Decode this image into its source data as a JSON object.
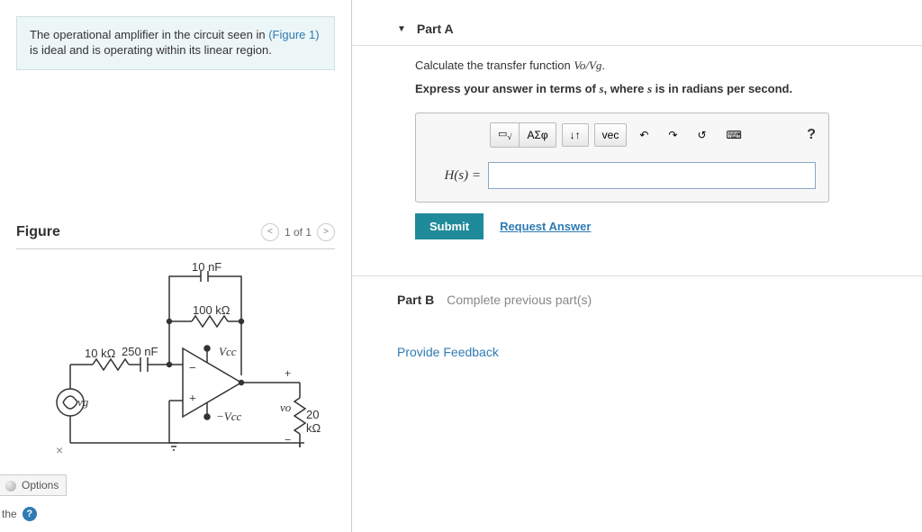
{
  "intro": {
    "text_before": "The operational amplifier in the circuit seen in ",
    "link": "(Figure 1)",
    "text_after": " is ideal and is operating within its linear region."
  },
  "figure": {
    "title": "Figure",
    "counter": "1 of 1",
    "labels": {
      "c_top": "10 nF",
      "r_fb": "100 kΩ",
      "r_in": "10 kΩ",
      "c_in": "250 nF",
      "vcc_pos": "Vcc",
      "vcc_neg": "−Vcc",
      "vg": "vg",
      "vo": "vo",
      "r_load": "20 kΩ",
      "plus": "+",
      "minus": "−"
    }
  },
  "options_label": "Options",
  "the_label": "the",
  "partA": {
    "header": "Part A",
    "prompt_pre": "Calculate the transfer function ",
    "prompt_expr": "Vo/Vg",
    "prompt_post": ".",
    "instruction_pre": "Express your answer in terms of ",
    "instruction_var": "s",
    "instruction_mid": ", where ",
    "instruction_var2": "s",
    "instruction_post": " is in radians per second.",
    "toolbar": {
      "templates": "▭√▭",
      "greek": "ΑΣφ",
      "subscript": "↓↑",
      "vec": "vec",
      "undo": "↶",
      "redo": "↷",
      "reset": "↺",
      "keyboard": "⌨",
      "help": "?"
    },
    "lhs": "H(s) =",
    "submit": "Submit",
    "request": "Request Answer"
  },
  "partB": {
    "label": "Part B",
    "msg": "Complete previous part(s)"
  },
  "feedback": "Provide Feedback"
}
